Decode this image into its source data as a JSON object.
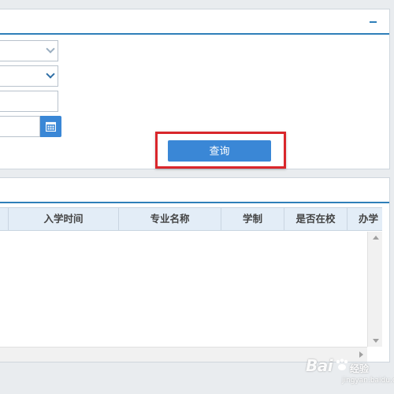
{
  "query_panel": {
    "query_button_label": "查询"
  },
  "results_table": {
    "columns": [
      {
        "label": ""
      },
      {
        "label": "入学时间"
      },
      {
        "label": "专业名称"
      },
      {
        "label": "学制"
      },
      {
        "label": "是否在校"
      },
      {
        "label": "办学"
      }
    ]
  },
  "watermark": {
    "brand": "Bai",
    "sub": "经验",
    "url": "jingyan.baidu.com"
  },
  "colors": {
    "accent": "#3a87d6",
    "header_line": "#2f7fb9",
    "highlight": "#d9262b",
    "table_header_bg": "#e3edf7"
  }
}
